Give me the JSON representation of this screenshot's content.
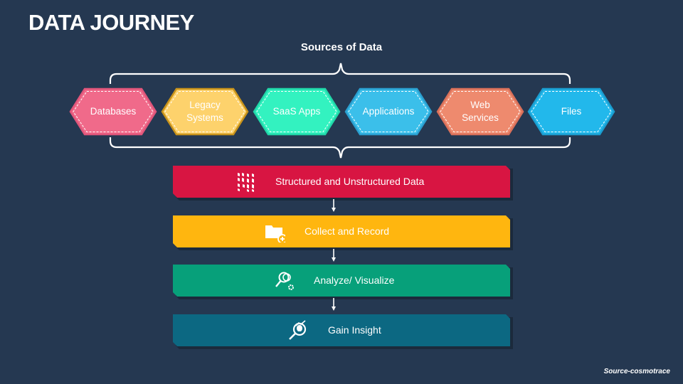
{
  "slide": {
    "title": "DATA JOURNEY",
    "subtitle": "Sources of Data",
    "source_note": "Source-cosmotrace",
    "background_color": "#253851"
  },
  "sources": [
    {
      "label": "Databases",
      "color": "#F06A8A",
      "border": "#E0557A"
    },
    {
      "label": "Legacy\nSystems",
      "color": "#FDD26C",
      "border": "#C9931A"
    },
    {
      "label": "SaaS Apps",
      "color": "#33F2C0",
      "border": "#20D6A8"
    },
    {
      "label": "Applications",
      "color": "#3BBFEA",
      "border": "#2A9FD0"
    },
    {
      "label": "Web\nServices",
      "color": "#EE8A6E",
      "border": "#D9705A"
    },
    {
      "label": "Files",
      "color": "#22B8EB",
      "border": "#1A9DD0"
    }
  ],
  "steps": [
    {
      "label": "Structured and Unstructured Data",
      "icon": "data-grid-icon",
      "color": "#D81542"
    },
    {
      "label": "Collect and Record",
      "icon": "folder-add-icon",
      "color": "#FFB60F"
    },
    {
      "label": "Analyze/ Visualize",
      "icon": "magnifier-gear-icon",
      "color": "#07A07A"
    },
    {
      "label": "Gain Insight",
      "icon": "insight-magnifier-icon",
      "color": "#0C6882"
    }
  ]
}
